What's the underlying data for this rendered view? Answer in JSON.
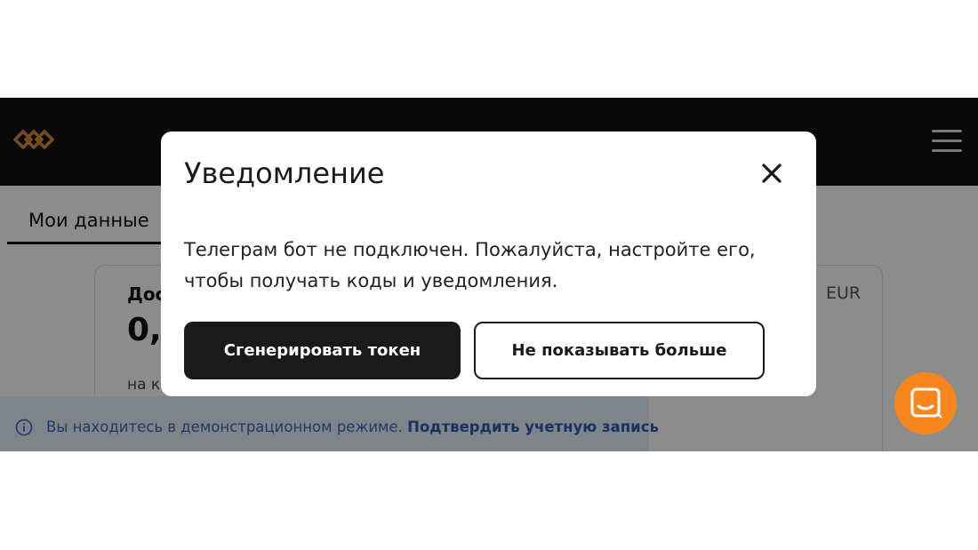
{
  "header": {
    "title": "",
    "logo_icon": "double-link-logo-icon",
    "menu_icon": "hamburger-menu-icon",
    "logo_color": "#d98b3a"
  },
  "tabs": {
    "active_label": "Мои данные"
  },
  "card": {
    "label": "Дос",
    "balance": "0,",
    "subtitle": "на к",
    "currency": "EUR"
  },
  "demo_banner": {
    "icon": "info-icon",
    "text": "Вы находитесь в демонстрационном режиме.",
    "link": "Подтвердить учетную запись"
  },
  "modal": {
    "title": "Уведомление",
    "close_icon": "close-icon",
    "message_line1": "Телеграм бот не подключен. Пожалуйста, настройте его,",
    "message_line2": "чтобы получать коды и уведомления.",
    "primary_button": "Сгенерировать токен",
    "secondary_button": "Не показывать больше"
  },
  "chat": {
    "icon": "chat-icon",
    "color": "#f7861e"
  }
}
